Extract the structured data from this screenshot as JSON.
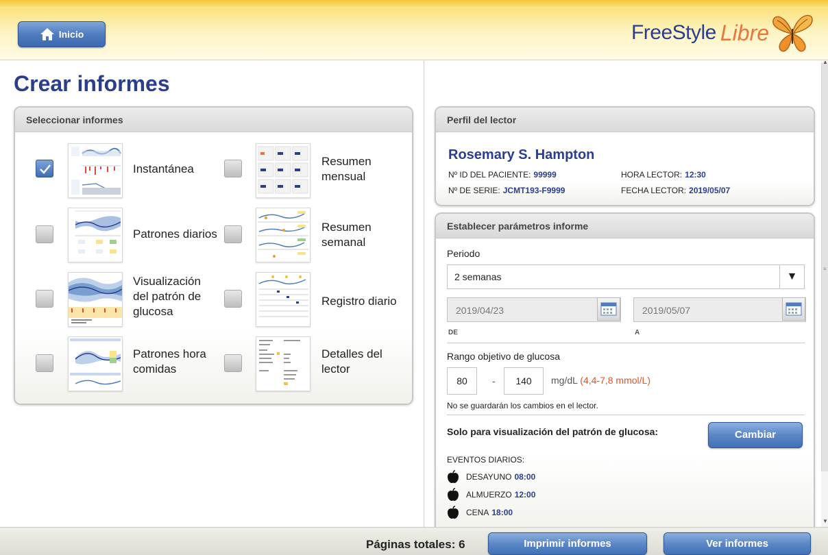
{
  "header": {
    "home_label": "Inicio",
    "brand_text": "FreeStyle",
    "brand_accent": "Libre",
    "home_icon": "home-icon",
    "logo_icon": "butterfly-icon"
  },
  "page": {
    "title": "Crear informes"
  },
  "select_reports": {
    "title": "Seleccionar informes",
    "items": [
      {
        "label": "Instantánea",
        "checked": true
      },
      {
        "label": "Resumen mensual",
        "checked": false
      },
      {
        "label": "Patrones diarios",
        "checked": false
      },
      {
        "label": "Resumen semanal",
        "checked": false
      },
      {
        "label": "Visualización del patrón de glucosa",
        "checked": false
      },
      {
        "label": "Registro diario",
        "checked": false
      },
      {
        "label": "Patrones hora comidas",
        "checked": false
      },
      {
        "label": "Detalles del lector",
        "checked": false
      }
    ]
  },
  "profile": {
    "title": "Perfil del lector",
    "patient_name": "Rosemary S. Hampton",
    "patient_id_label": "Nº ID DEL PACIENTE:",
    "patient_id": "99999",
    "reader_time_label": "HORA LECTOR:",
    "reader_time": "12:30",
    "serial_label": "Nº DE SERIE:",
    "serial": "JCMT193-F9999",
    "reader_date_label": "FECHA LECTOR:",
    "reader_date": "2019/05/07"
  },
  "params": {
    "title": "Establecer parámetros informe",
    "period_label": "Periodo",
    "period_value": "2 semanas",
    "date_from": "2019/04/23",
    "date_from_label": "DE",
    "date_to": "2019/05/07",
    "date_to_label": "A",
    "range_label": "Rango objetivo de glucosa",
    "range_low": "80",
    "range_sep": "-",
    "range_high": "140",
    "range_unit": "mg/dL",
    "range_mmol": "(4,4-7,8 mmol/L)",
    "note": "No se guardarán los cambios en el lector.",
    "agp_label": "Solo para visualización del patrón de glucosa:",
    "change_button": "Cambiar",
    "events_label": "EVENTOS DIARIOS:",
    "events": [
      {
        "name": "DESAYUNO",
        "time": "08:00"
      },
      {
        "name": "ALMUERZO",
        "time": "12:00"
      },
      {
        "name": "CENA",
        "time": "18:00"
      }
    ]
  },
  "footer": {
    "total_pages": "Páginas totales: 6",
    "print_button": "Imprimir informes",
    "view_button": "Ver informes"
  },
  "colors": {
    "brand_blue": "#2a3e8c",
    "brand_orange": "#e8763b",
    "button_blue": "#4f7dc0",
    "alert_orange": "#e0552a"
  }
}
